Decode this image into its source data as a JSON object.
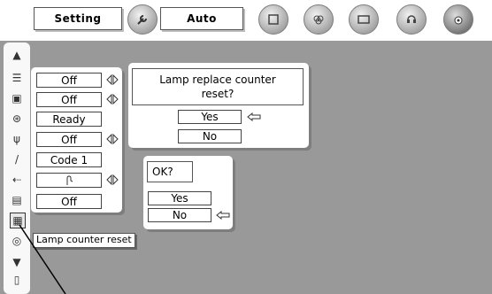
{
  "toolbar": {
    "setting_label": "Setting",
    "auto_label": "Auto",
    "icons": [
      "setting-wrench-icon",
      "screen-icon",
      "color-icon",
      "image-icon",
      "sound-icon",
      "lens-icon"
    ]
  },
  "sidebar": {
    "icons": [
      "scroll-up-icon",
      "keystone-icon",
      "background-icon",
      "display-icon",
      "power-mgmt-icon",
      "remote-icon",
      "usb-icon",
      "lock-icon",
      "lamp-counter-icon",
      "filter-icon",
      "scroll-down-icon",
      "exit-icon"
    ]
  },
  "settings_list": [
    "Off",
    "Off",
    "Ready",
    "Off",
    "Code 1",
    "",
    "Off"
  ],
  "tooltip": {
    "text": "Lamp counter reset"
  },
  "dialog1": {
    "message_line1": "Lamp replace counter",
    "message_line2": "reset?",
    "yes": "Yes",
    "no": "No"
  },
  "dialog2": {
    "message": "OK?",
    "yes": "Yes",
    "no": "No"
  }
}
